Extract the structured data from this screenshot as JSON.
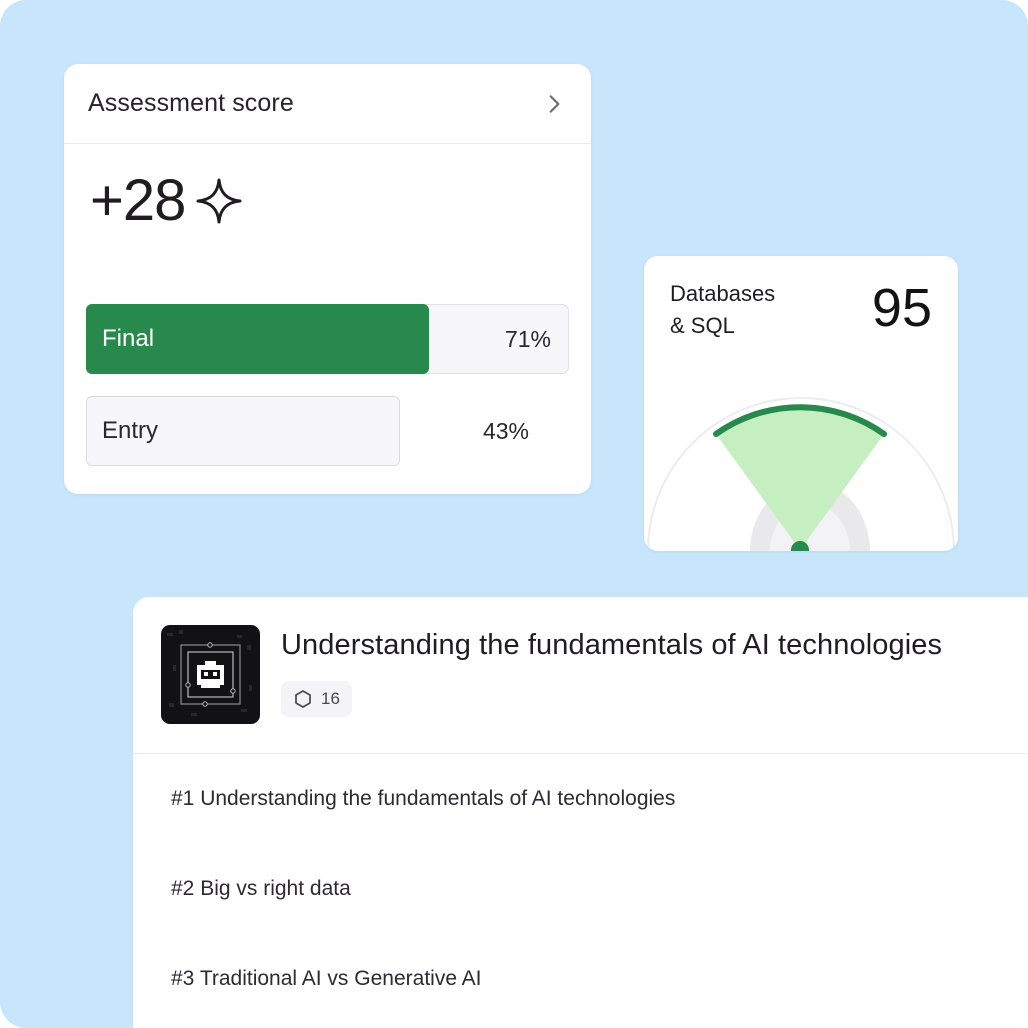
{
  "assessment": {
    "title": "Assessment score",
    "score": "+28",
    "icons": {
      "open": "chevron-right-icon",
      "score": "sparkle-icon"
    },
    "bars": [
      {
        "label": "Final",
        "percent_text": "71%",
        "fill_fraction": 0.71,
        "color": "#27894b"
      },
      {
        "label": "Entry",
        "percent_text": "43%",
        "fill_fraction": 0.65,
        "color": "#f7f6f9"
      }
    ]
  },
  "gauge": {
    "title_line1": "Databases",
    "title_line2": "& SQL",
    "value": "95",
    "colors": {
      "arc": "#27894b",
      "wedge": "#c5eec1",
      "track": "#e9e9ec"
    }
  },
  "course": {
    "title": "Understanding the fundamentals of AI technologies",
    "lesson_count": "16",
    "thumbnail_icon": "robot-icon",
    "badge_icon": "hexagon-icon",
    "lessons": [
      "#1 Understanding the fundamentals of AI technologies",
      "#2 Big vs right data",
      "#3 Traditional AI vs Generative AI"
    ]
  }
}
